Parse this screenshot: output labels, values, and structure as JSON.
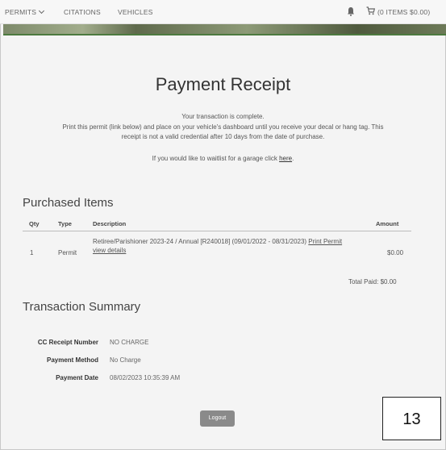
{
  "nav": {
    "items": [
      {
        "label": "PERMITS"
      },
      {
        "label": "CITATIONS"
      },
      {
        "label": "VEHICLES"
      }
    ],
    "cart_text": "(0 ITEMS $0.00)"
  },
  "page": {
    "title": "Payment Receipt",
    "complete_msg": "Your transaction is complete.",
    "print_msg_line1": "Print this permit (link below) and place on your vehicle's dashboard until you receive your decal or hang tag.  This",
    "print_msg_line2": "receipt is not a valid credential after 10 days from the date of purchase.",
    "waitlist_prefix": "If you would like to waitlist for a garage click ",
    "waitlist_link": "here",
    "waitlist_suffix": "."
  },
  "purchased": {
    "title": "Purchased Items",
    "columns": {
      "qty": "Qty",
      "type": "Type",
      "description": "Description",
      "amount": "Amount"
    },
    "rows": [
      {
        "qty": "1",
        "type": "Permit",
        "description": "Retiree/Parishioner 2023-24 / Annual [R240018] (09/01/2022 - 08/31/2023) ",
        "print_link": "Print Permit",
        "details_link": "view details",
        "amount": "$0.00"
      }
    ],
    "total": "Total Paid: $0.00"
  },
  "summary": {
    "title": "Transaction Summary",
    "fields": [
      {
        "label": "CC Receipt Number",
        "value": "NO CHARGE"
      },
      {
        "label": "Payment Method",
        "value": "No Charge"
      },
      {
        "label": "Payment Date",
        "value": "08/02/2023 10:35:39 AM"
      }
    ]
  },
  "logout_label": "Logout",
  "page_number": "13"
}
